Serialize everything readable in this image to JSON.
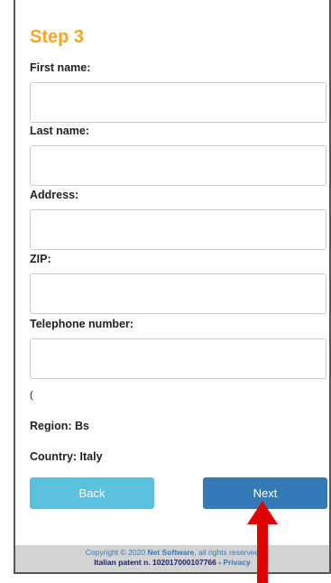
{
  "step_title": "Step 3",
  "form": {
    "first_name_label": "First name:",
    "last_name_label": "Last name:",
    "address_label": "Address:",
    "zip_label": "ZIP:",
    "telephone_label": "Telephone number:",
    "first_name_value": "",
    "last_name_value": "",
    "address_value": "",
    "zip_value": "",
    "telephone_value": "",
    "cut_off_text": "("
  },
  "info": {
    "region": "Region: Bs",
    "country": "Country: Italy"
  },
  "buttons": {
    "back_label": "Back",
    "next_label": "Next"
  },
  "footer": {
    "copyright_prefix": "Copyright © 2020",
    "company": "Net Software",
    "rights": ", all rights reserved",
    "patent": "Italian patent n. 102017000107766 - ",
    "privacy": "Privacy"
  },
  "colors": {
    "title": "#f5a623",
    "back_button": "#5bc0de",
    "next_button": "#337ab7",
    "footer_bg": "#d3d3d3",
    "annotation_arrow": "#e00000"
  }
}
